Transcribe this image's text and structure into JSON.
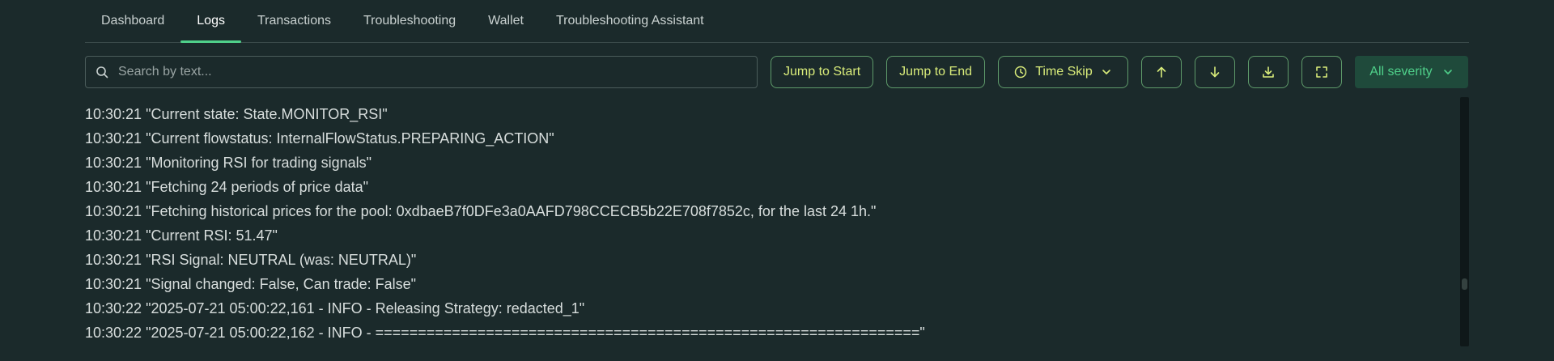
{
  "tabs": [
    {
      "label": "Dashboard",
      "active": false
    },
    {
      "label": "Logs",
      "active": true
    },
    {
      "label": "Transactions",
      "active": false
    },
    {
      "label": "Troubleshooting",
      "active": false
    },
    {
      "label": "Wallet",
      "active": false
    },
    {
      "label": "Troubleshooting Assistant",
      "active": false
    }
  ],
  "toolbar": {
    "search_placeholder": "Search by text...",
    "jump_start": "Jump to Start",
    "jump_end": "Jump to End",
    "time_skip": "Time Skip",
    "severity": "All severity"
  },
  "colors": {
    "background": "#1b2a2b",
    "accent_green": "#4fd08a",
    "button_text": "#d9ec7a",
    "button_border": "#5e9a6a",
    "severity_bg": "#1f4a3b"
  },
  "logs": [
    {
      "time": "10:30:21",
      "message": "\"Current state: State.MONITOR_RSI\""
    },
    {
      "time": "10:30:21",
      "message": "\"Current flowstatus: InternalFlowStatus.PREPARING_ACTION\""
    },
    {
      "time": "10:30:21",
      "message": "\"Monitoring RSI for trading signals\""
    },
    {
      "time": "10:30:21",
      "message": "\"Fetching 24 periods of price data\""
    },
    {
      "time": "10:30:21",
      "message": "\"Fetching historical prices for the pool: 0xdbaeB7f0DFe3a0AAFD798CCECB5b22E708f7852c, for the last 24 1h.\""
    },
    {
      "time": "10:30:21",
      "message": "\"Current RSI: 51.47\""
    },
    {
      "time": "10:30:21",
      "message": "\"RSI Signal: NEUTRAL (was: NEUTRAL)\""
    },
    {
      "time": "10:30:21",
      "message": "\"Signal changed: False, Can trade: False\""
    },
    {
      "time": "10:30:22",
      "message": "\"2025-07-21 05:00:22,161 - INFO - Releasing Strategy: redacted_1\""
    },
    {
      "time": "10:30:22",
      "message": "\"2025-07-21 05:00:22,162 - INFO - ================================================================\""
    }
  ]
}
